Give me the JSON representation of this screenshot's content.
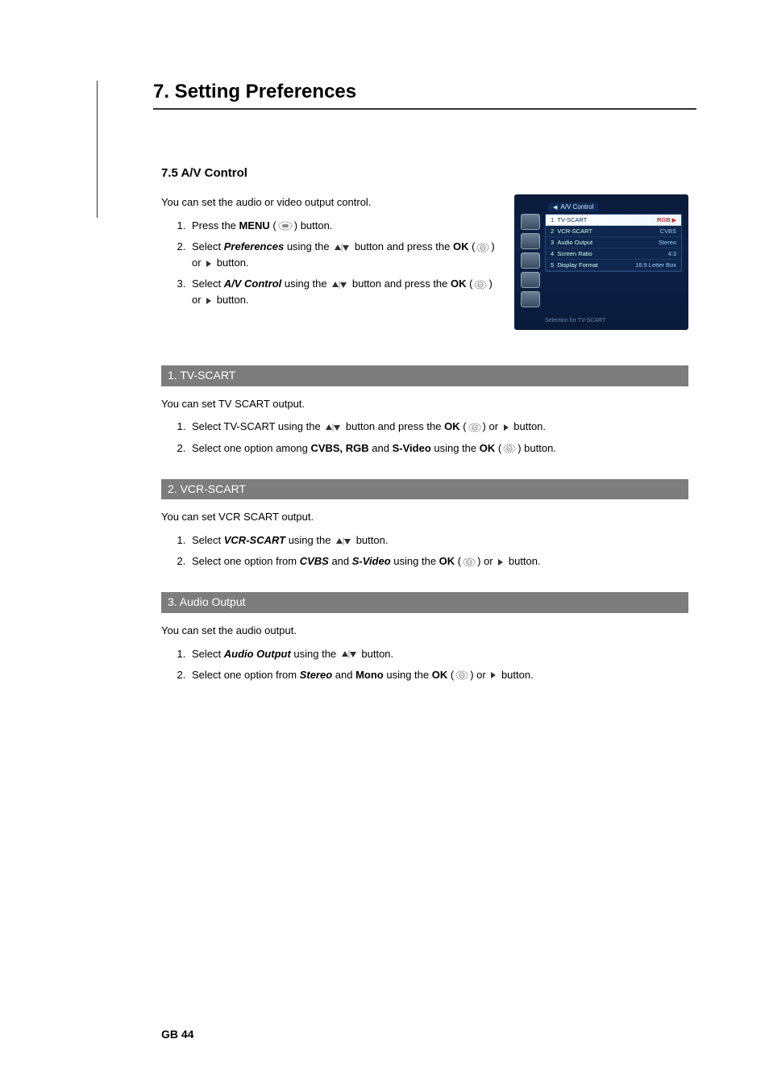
{
  "chapter": {
    "title": "7. Setting Preferences"
  },
  "section": {
    "title": "7.5 A/V Control",
    "intro": "You can set the audio or video output control."
  },
  "steps_main": {
    "s1_a": "Press the ",
    "s1_b": "MENU",
    "s1_c": " (",
    "s1_d": ") button.",
    "s2_a": "Select ",
    "s2_b": "Preferences",
    "s2_c": " using the ",
    "s2_d": " button and press the ",
    "s2_e": "OK",
    "s2_f": " (",
    "s2_g": ") or ",
    "s2_h": " button.",
    "s3_a": "Select ",
    "s3_b": "A/V Control",
    "s3_c": " using the ",
    "s3_d": " button and press the ",
    "s3_e": "OK",
    "s3_f": " (",
    "s3_g": ") or ",
    "s3_h": " button."
  },
  "sub1": {
    "header": "1. TV-SCART",
    "intro": "You can set TV SCART output.",
    "s1_a": "Select TV-SCART using the ",
    "s1_b": " button and press the ",
    "s1_c": "OK",
    "s1_d": " (",
    "s1_e": ") or ",
    "s1_f": " button.",
    "s2_a": "Select one option among ",
    "s2_b": "CVBS, RGB",
    "s2_c": " and ",
    "s2_d": "S-Video",
    "s2_e": " using the ",
    "s2_f": "OK",
    "s2_g": " (",
    "s2_h": ") button."
  },
  "sub2": {
    "header": "2. VCR-SCART",
    "intro": "You can set VCR SCART output.",
    "s1_a": "Select ",
    "s1_b": "VCR-SCART",
    "s1_c": " using the ",
    "s1_d": " button.",
    "s2_a": "Select one option from ",
    "s2_b": "CVBS",
    "s2_c": " and ",
    "s2_d": "S-Video",
    "s2_e": " using the ",
    "s2_f": "OK",
    "s2_g": " (",
    "s2_h": ") or ",
    "s2_i": " button."
  },
  "sub3": {
    "header": "3. Audio Output",
    "intro": "You can set the audio output.",
    "s1_a": "Select ",
    "s1_b": "Audio Output",
    "s1_c": " using the ",
    "s1_d": " button.",
    "s2_a": "Select one option from ",
    "s2_b": "Stereo",
    "s2_c": " and ",
    "s2_d": "Mono",
    "s2_e": " using the ",
    "s2_f": "OK",
    "s2_g": " (",
    "s2_h": ") or ",
    "s2_i": " button."
  },
  "screenshot": {
    "title": "A/V Control",
    "rows": [
      {
        "num": "1",
        "label": "TV-SCART",
        "value": "RGB"
      },
      {
        "num": "2",
        "label": "VCR-SCART",
        "value": "CVBS"
      },
      {
        "num": "3",
        "label": "Audio Output",
        "value": "Stereo"
      },
      {
        "num": "4",
        "label": "Screen Ratio",
        "value": "4:3"
      },
      {
        "num": "5",
        "label": "Display Format",
        "value": "16:9 Letter Box"
      }
    ],
    "footer": "Selection for TV-SCART"
  },
  "page_number": "GB 44"
}
